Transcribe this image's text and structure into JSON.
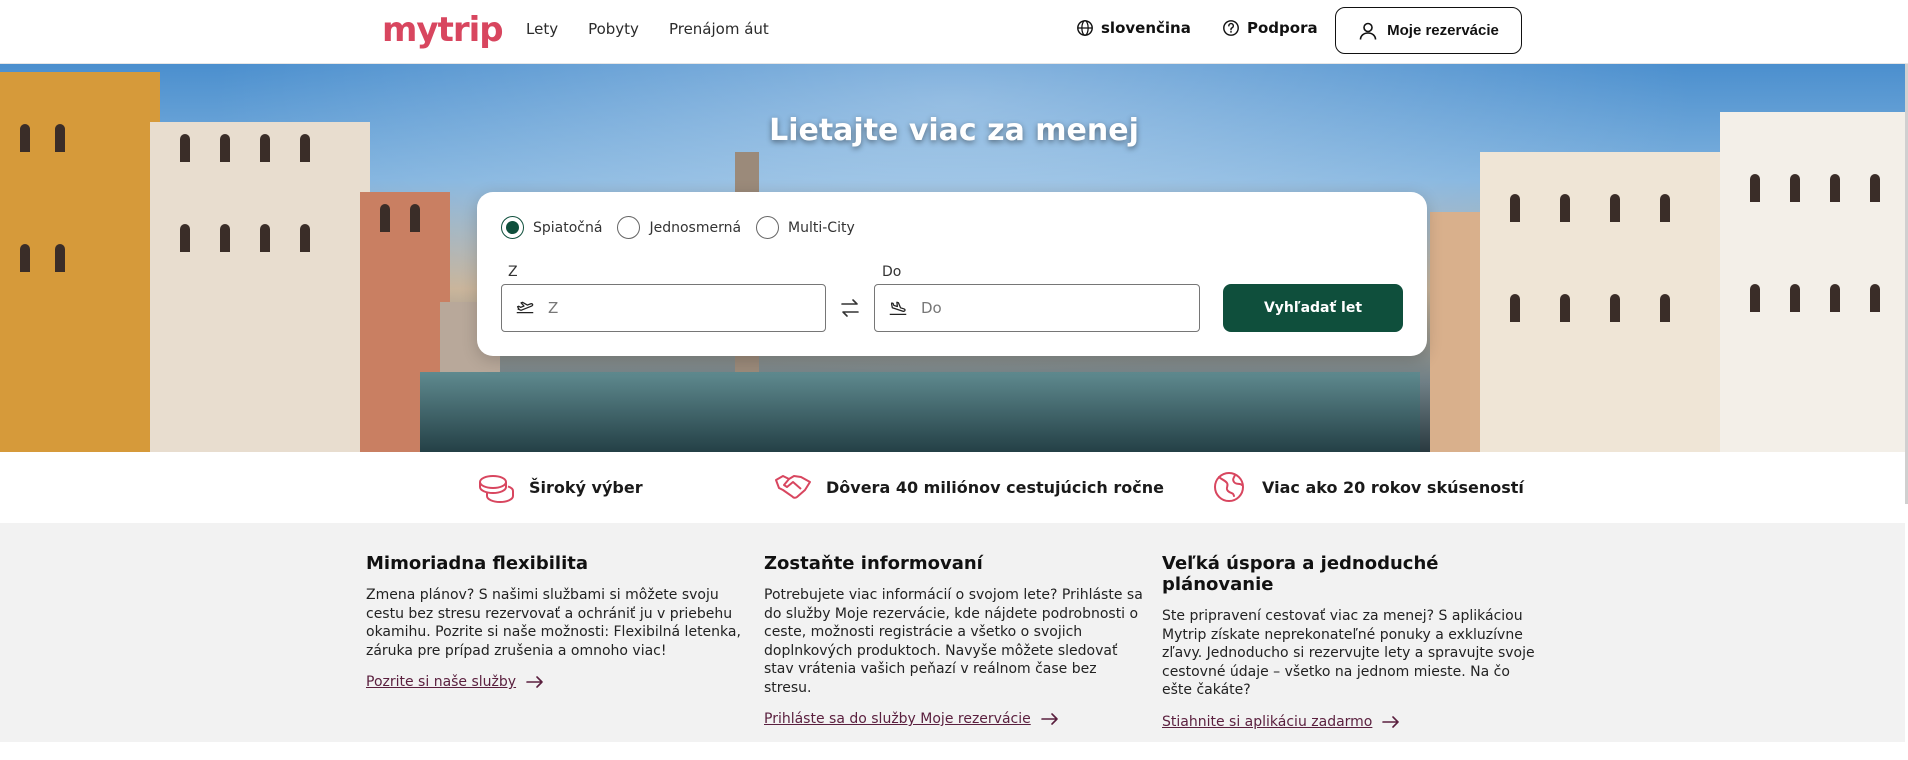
{
  "header": {
    "logo": "mytrip",
    "nav": [
      "Lety",
      "Pobyty",
      "Prenájom áut"
    ],
    "language": "slovenčina",
    "support": "Podpora",
    "my_bookings": "Moje rezervácie"
  },
  "hero": {
    "title": "Lietajte viac za menej"
  },
  "search": {
    "trip_types": [
      "Spiatočná",
      "Jednosmerná",
      "Multi-City"
    ],
    "selected_trip_type": "Spiatočná",
    "from_label": "Z",
    "from_placeholder": "Z",
    "to_label": "Do",
    "to_placeholder": "Do",
    "button": "Vyhľadať let"
  },
  "features": [
    {
      "icon": "coins-icon",
      "text": "Široký výber"
    },
    {
      "icon": "handshake-icon",
      "text": "Dôvera 40 miliónov cestujúcich ročne"
    },
    {
      "icon": "globe-icon",
      "text": "Viac ako 20 rokov skúseností"
    }
  ],
  "info": [
    {
      "title": "Mimoriadna flexibilita",
      "text": "Zmena plánov? S našimi službami si môžete svoju cestu bez stresu rezervovať a ochrániť ju v priebehu okamihu. Pozrite si naše možnosti: Flexibilná letenka, záruka pre prípad zrušenia a omnoho viac!",
      "link": "Pozrite si naše služby"
    },
    {
      "title": "Zostaňte informovaní",
      "text": "Potrebujete viac informácií o svojom lete? Prihláste sa do služby Moje rezervácie, kde nájdete podrobnosti o ceste, možnosti registrácie a všetko o svojich doplnkových produktoch. Navyše môžete sledovať stav vrátenia vašich peňazí v reálnom čase bez stresu.",
      "link": "Prihláste sa do služby Moje rezervácie"
    },
    {
      "title": "Veľká úspora a jednoduché plánovanie",
      "text": "Ste pripravení cestovať viac za menej? S aplikáciou Mytrip získate neprekonateľné ponuky a exkluzívne zľavy. Jednoducho si rezervujte lety a spravujte svoje cestovné údaje – všetko na jednom mieste. Na čo ešte čakáte?",
      "link": "Stiahnite si aplikáciu zadarmo"
    }
  ],
  "colors": {
    "brand": "#d8465f",
    "primary": "#0f4f3c",
    "link": "#5a1f3e"
  }
}
